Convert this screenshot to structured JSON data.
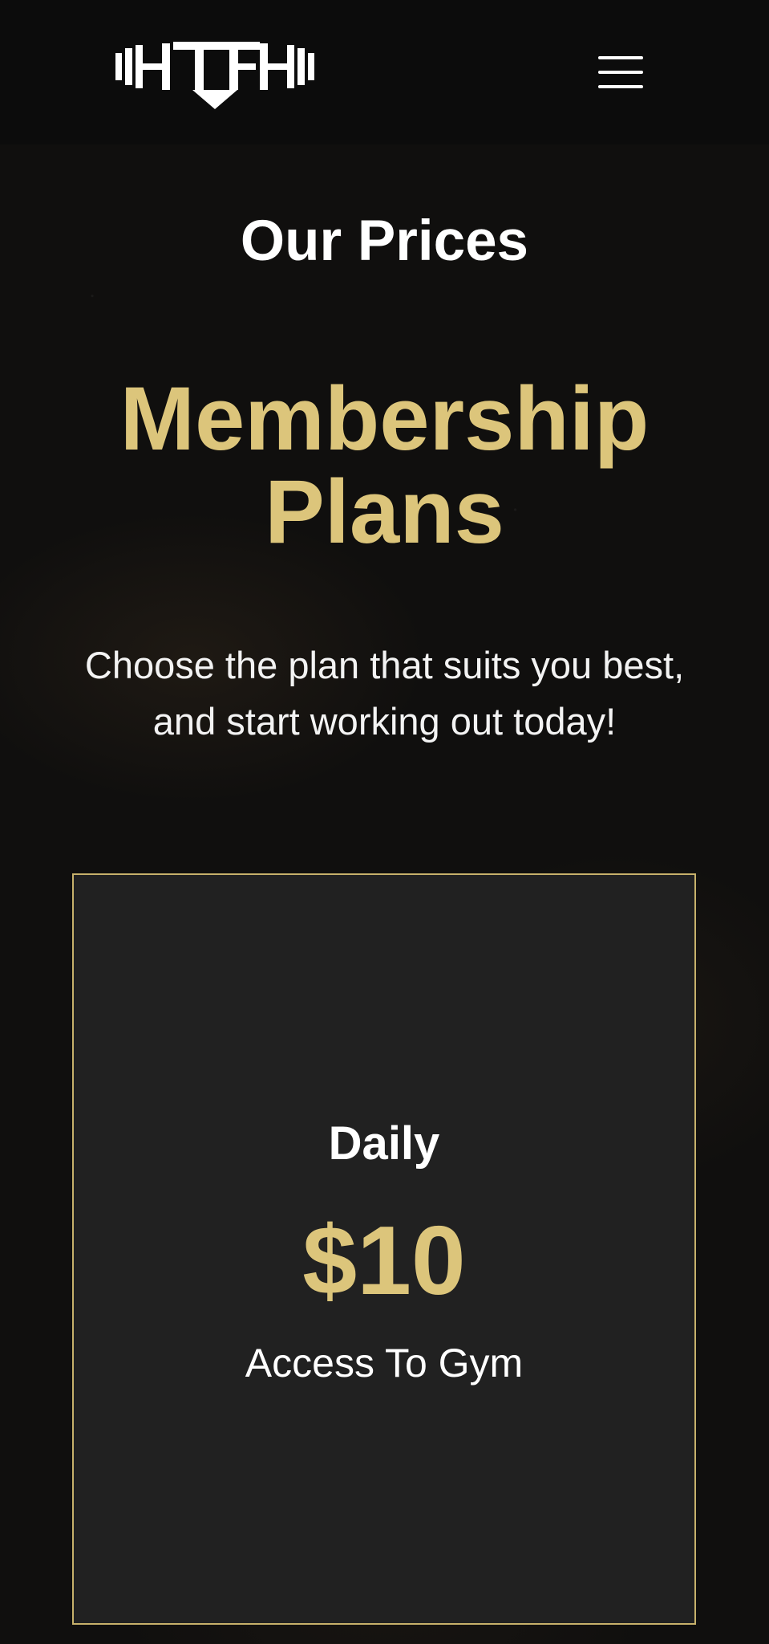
{
  "header": {
    "logo_icon": "dumbbell-logo-icon",
    "menu_icon": "hamburger-menu-icon"
  },
  "hero": {
    "eyebrow": "Our Prices",
    "title": "Membership Plans",
    "subtitle": "Choose the plan that suits you best, and start working out today!"
  },
  "plans": [
    {
      "name": "Daily",
      "price": "$10",
      "description": "Access To Gym"
    }
  ],
  "colors": {
    "accent": "#dcc57b",
    "card_border": "#c7b16b",
    "card_background": "#222222",
    "page_background": "#100f0e",
    "header_background": "#0c0c0c"
  }
}
